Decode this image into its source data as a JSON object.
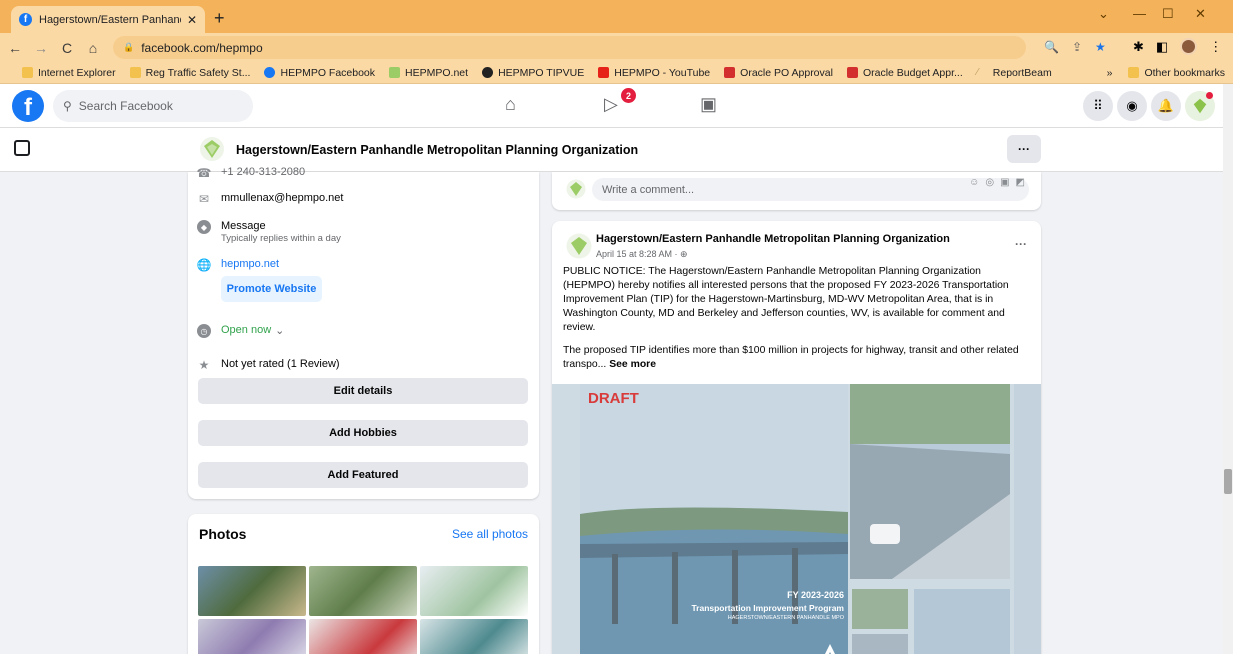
{
  "browser": {
    "tab_title": "Hagerstown/Eastern Panhandle",
    "address": "facebook.com/hepmpo",
    "bookmarks": [
      {
        "label": "Internet Explorer",
        "color": "#f2c14e"
      },
      {
        "label": "Reg Traffic Safety St...",
        "color": "#f2c14e"
      },
      {
        "label": "HEPMPO Facebook",
        "color": "#1877f2"
      },
      {
        "label": "HEPMPO.net",
        "color": "#9ccc65"
      },
      {
        "label": "HEPMPO TIPVUE",
        "color": "#222222"
      },
      {
        "label": "HEPMPO - YouTube",
        "color": "#e62117"
      },
      {
        "label": "Oracle PO Approval",
        "color": "#d32f2f"
      },
      {
        "label": "Oracle Budget Appr...",
        "color": "#d32f2f"
      },
      {
        "label": "ReportBeam",
        "color": "#c0a060"
      }
    ],
    "overflow": "»",
    "other_bookmarks": "Other bookmarks"
  },
  "facebook": {
    "search_placeholder": "Search Facebook",
    "watch_badge": "2",
    "page_name": "Hagerstown/Eastern Panhandle Metropolitan Planning Organization",
    "more_label": "···"
  },
  "intro": {
    "phone_partial": "+1 240-313-2080",
    "email": "mmullenax@hepmpo.net",
    "message_label": "Message",
    "message_sub": "Typically replies within a day",
    "website": "hepmpo.net",
    "promote_label": "Promote Website",
    "hours": "Open now",
    "rating": "Not yet rated (1 Review)",
    "edit_details": "Edit details",
    "add_hobbies": "Add Hobbies",
    "add_featured": "Add Featured"
  },
  "photos": {
    "title": "Photos",
    "see_all": "See all photos"
  },
  "comment": {
    "placeholder": "Write a comment..."
  },
  "post": {
    "author": "Hagerstown/Eastern Panhandle Metropolitan Planning Organization",
    "date": "April 15 at 8:28 AM · ",
    "text": "PUBLIC NOTICE: The Hagerstown/Eastern Panhandle Metropolitan Planning Organization (HEPMPO) hereby notifies all interested persons that the proposed FY 2023-2026 Transportation Improvement Plan (TIP) for the Hagerstown-Martinsburg, MD-WV Metropolitan Area, that is in Washington County, MD and Berkeley and Jefferson counties, WV, is available for comment and review.",
    "text2": "The proposed TIP identifies more than $100 million in projects for highway, transit and other related transpo...",
    "see_more": "See more",
    "image_draft": "DRAFT",
    "image_fy": "FY 2023-2026",
    "image_title": "Transportation Improvement Program",
    "image_org": "HAGERSTOWN/EASTERN PANHANDLE MPO"
  }
}
